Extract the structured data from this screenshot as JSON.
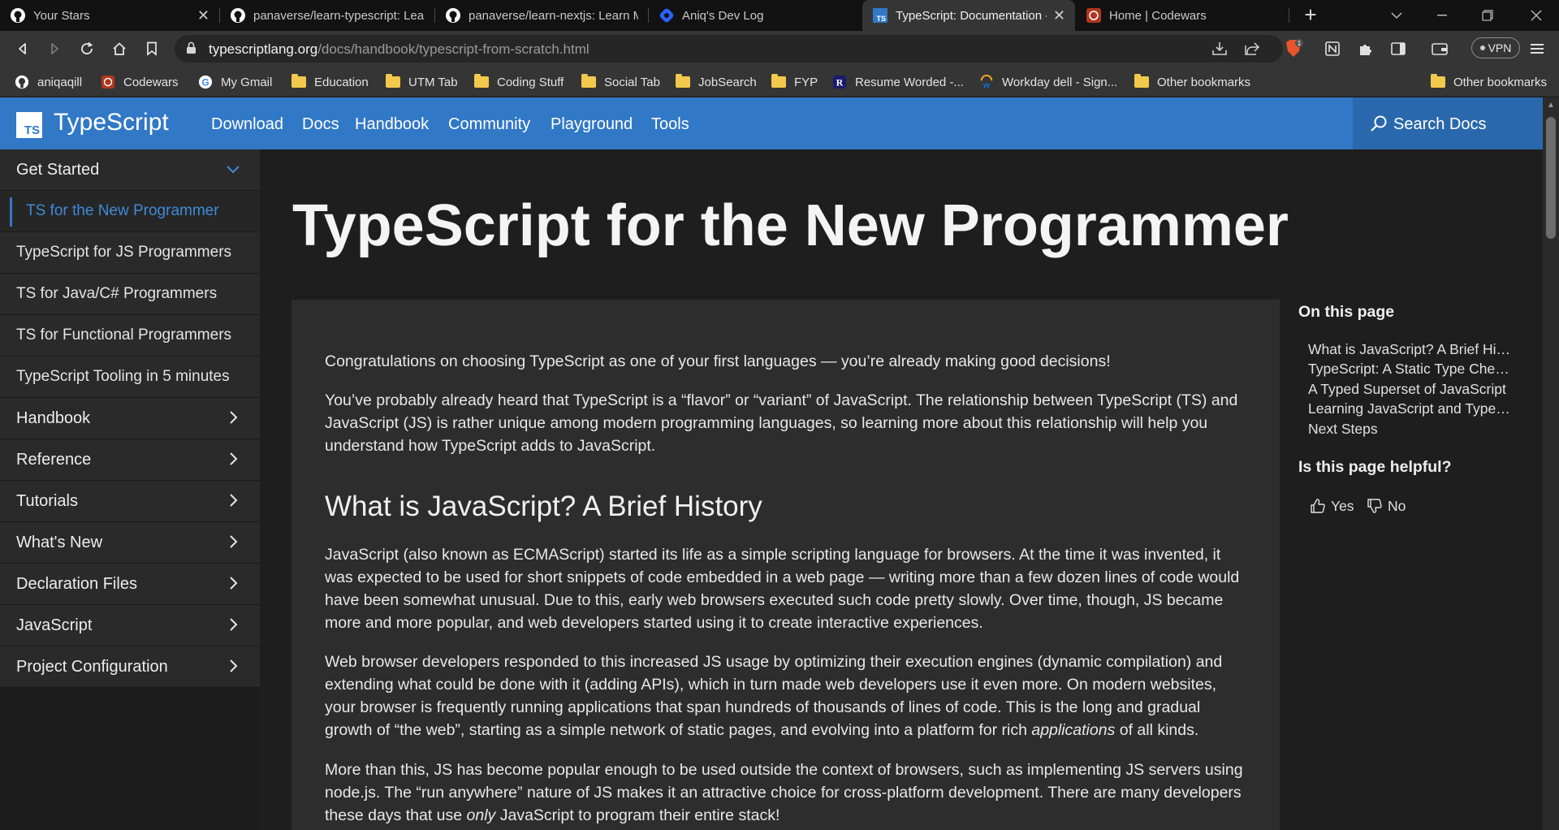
{
  "browser": {
    "tabs": [
      {
        "label": "Your Stars",
        "icon": "github-icon",
        "active": false
      },
      {
        "label": "panaverse/learn-typescript: Learn",
        "icon": "github-icon",
        "active": false
      },
      {
        "label": "panaverse/learn-nextjs: Learn Mo",
        "icon": "github-icon",
        "active": false
      },
      {
        "label": "Aniq's Dev Log",
        "icon": "hashnode-icon",
        "active": false
      },
      {
        "label": "TypeScript: Documentation -",
        "icon": "typescript-icon",
        "active": true
      },
      {
        "label": "Home | Codewars",
        "icon": "codewars-icon",
        "active": false
      }
    ],
    "url_host": "typescriptlang.org",
    "url_path": "/docs/handbook/typescript-from-scratch.html",
    "brave_badge": "1",
    "vpn_label": "VPN"
  },
  "bookmarks": [
    {
      "label": "aniqaqill",
      "icon": "github-icon"
    },
    {
      "label": "Codewars",
      "icon": "codewars-icon"
    },
    {
      "label": "My Gmail",
      "icon": "google-icon"
    },
    {
      "label": "Education",
      "icon": "folder-icon"
    },
    {
      "label": "UTM Tab",
      "icon": "folder-icon"
    },
    {
      "label": "Coding Stuff",
      "icon": "folder-icon"
    },
    {
      "label": "Social Tab",
      "icon": "folder-icon"
    },
    {
      "label": "JobSearch",
      "icon": "folder-icon"
    },
    {
      "label": "FYP",
      "icon": "folder-icon"
    },
    {
      "label": "Resume Worded -...",
      "icon": "resume-worded-icon"
    },
    {
      "label": "Workday dell - Sign...",
      "icon": "workday-icon"
    },
    {
      "label": "Other bookmarks",
      "icon": "folder-icon"
    },
    {
      "label": "Other bookmarks",
      "icon": "folder-icon"
    }
  ],
  "site": {
    "brand": "TypeScript",
    "logo_text": "TS",
    "nav": [
      "Download",
      "Docs",
      "Handbook",
      "Community",
      "Playground",
      "Tools"
    ],
    "search_label": "Search Docs",
    "accent": "#3178c6"
  },
  "sidebar": {
    "get_started": "Get Started",
    "sub_items": [
      {
        "label": "TS for the New Programmer",
        "active": true
      },
      {
        "label": "TypeScript for JS Programmers",
        "active": false
      },
      {
        "label": "TS for Java/C# Programmers",
        "active": false
      },
      {
        "label": "TS for Functional Programmers",
        "active": false
      },
      {
        "label": "TypeScript Tooling in 5 minutes",
        "active": false
      }
    ],
    "sections": [
      "Handbook",
      "Reference",
      "Tutorials",
      "What's New",
      "Declaration Files",
      "JavaScript",
      "Project Configuration"
    ]
  },
  "article": {
    "title": "TypeScript for the New Programmer",
    "intro": "Congratulations on choosing TypeScript as one of your first languages — you’re already making good decisions!",
    "p1": "You’ve probably already heard that TypeScript is a “flavor” or “variant” of JavaScript. The relationship between TypeScript (TS) and JavaScript (JS) is rather unique among modern programming languages, so learning more about this relationship will help you understand how TypeScript adds to JavaScript.",
    "h2": "What is JavaScript? A Brief History",
    "p2": "JavaScript (also known as ECMAScript) started its life as a simple scripting language for browsers. At the time it was invented, it was expected to be used for short snippets of code embedded in a web page — writing more than a few dozen lines of code would have been somewhat unusual. Due to this, early web browsers executed such code pretty slowly. Over time, though, JS became more and more popular, and web developers started using it to create interactive experiences.",
    "p3_a": "Web browser developers responded to this increased JS usage by optimizing their execution engines (dynamic compilation) and extending what could be done with it (adding APIs), which in turn made web developers use it even more. On modern websites, your browser is frequently running applications that span hundreds of thousands of lines of code. This is the long and gradual growth of “the web”, starting as a simple network of static pages, and evolving into a platform for rich ",
    "p3_em": "applications",
    "p3_b": " of all kinds.",
    "p4_a": "More than this, JS has become popular enough to be used outside the context of browsers, such as implementing JS servers using node.js. The “run anywhere” nature of JS makes it an attractive choice for cross-platform development. There are many developers these days that use ",
    "p4_em": "only",
    "p4_b": " JavaScript to program their entire stack!"
  },
  "rail": {
    "on_this_page": "On this page",
    "links": [
      "What is JavaScript? A Brief His...",
      "TypeScript: A Static Type Chec...",
      "A Typed Superset of JavaScript",
      "Learning JavaScript and TypeS...",
      "Next Steps"
    ],
    "helpful": "Is this page helpful?",
    "yes": "Yes",
    "no": "No"
  }
}
